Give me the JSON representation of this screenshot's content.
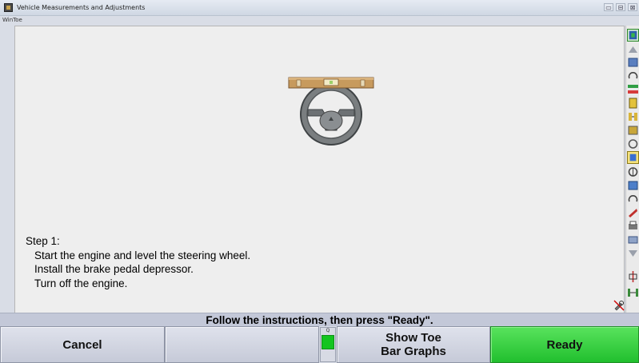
{
  "window": {
    "title": "Vehicle Measurements and Adjustments",
    "controls": [
      "▭",
      "⊟",
      "⊠"
    ]
  },
  "app": {
    "subtitle": "WinToe"
  },
  "instructions": {
    "step_label": "Step 1:",
    "lines": [
      "Start the engine and level the steering wheel.",
      "Install the brake pedal depressor.",
      "Turn off the engine."
    ]
  },
  "status": {
    "message": "Follow the instructions, then press \"Ready\"."
  },
  "buttons": {
    "cancel": "Cancel",
    "blank": "",
    "show_toe_line1": "Show Toe",
    "show_toe_line2": "Bar Graphs",
    "ready": "Ready"
  },
  "indicator": {
    "label": "Q"
  },
  "colors": {
    "ready_green": "#2ccf38",
    "status_bar": "#c3c8d8",
    "button_face": "#d3d6e2",
    "leveler_wood": "#c79a5d"
  },
  "sidebar_icons": [
    "toe-adjust-icon",
    "scroll-up-icon",
    "wheel-sensor-icon",
    "turn-icon",
    "caster-swing-icon",
    "vehicle-toe-icon",
    "axle-icon",
    "camber-icon",
    "front-wheels-icon",
    "active-procedure-icon",
    "steering-icon",
    "sensor-head-icon",
    "turn-back-icon",
    "brake-icon",
    "print-icon",
    "tilt-icon",
    "scroll-down-icon",
    "alignment-icon",
    "rear-axle-icon"
  ]
}
